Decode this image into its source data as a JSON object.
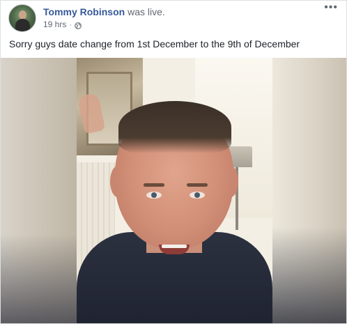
{
  "post": {
    "author": "Tommy Robinson",
    "action": "was live.",
    "timestamp": "19 hrs",
    "separator": "·",
    "privacy_icon": "globe-icon",
    "more_label": "•••",
    "text": "Sorry guys date change from 1st December to the 9th of December"
  },
  "colors": {
    "link": "#365899",
    "meta_text": "#616770",
    "body_text": "#1d2129"
  }
}
